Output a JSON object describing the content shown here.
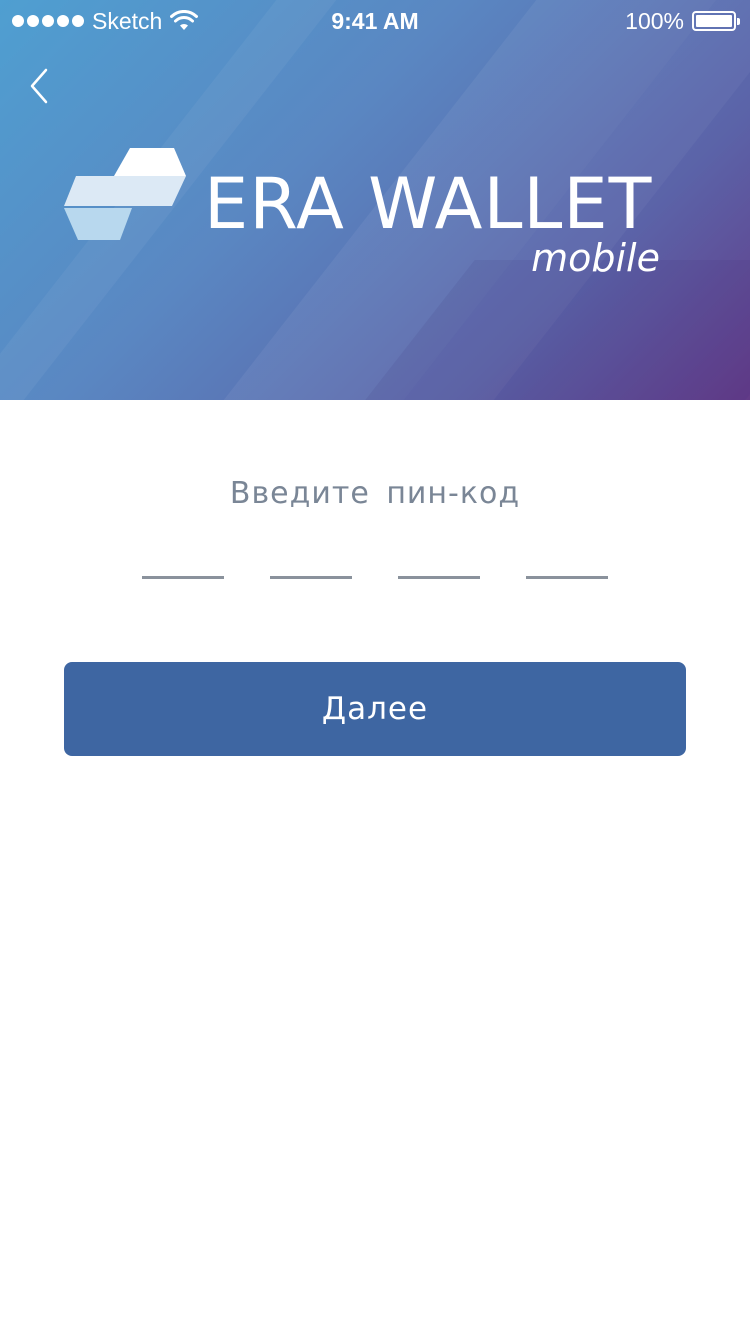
{
  "status_bar": {
    "carrier": "Sketch",
    "time": "9:41 AM",
    "battery_percent": "100%"
  },
  "header": {
    "back_icon": "chevron-left-icon",
    "logo_icon": "era-wallet-logo-icon",
    "brand_name": "ERA WALLET",
    "brand_sub": "mobile"
  },
  "pin": {
    "prompt": "Введите пин-код",
    "slots": [
      "",
      "",
      "",
      ""
    ],
    "next_label": "Далее"
  },
  "colors": {
    "gradient_start": "#4f9fd1",
    "gradient_end": "#633b88",
    "primary_button": "#3e66a2",
    "prompt_text": "#7a8696"
  }
}
